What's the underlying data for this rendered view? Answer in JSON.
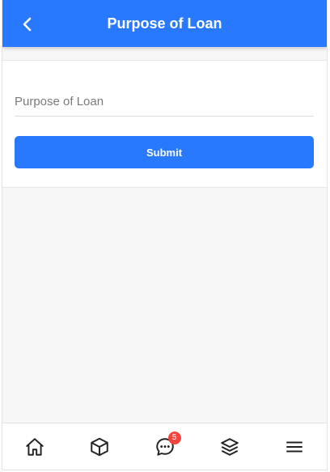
{
  "header": {
    "title": "Purpose of Loan",
    "back_icon": "chevron-left-icon",
    "background_color": "#2979ff"
  },
  "form": {
    "purpose_field": {
      "placeholder": "Purpose of Loan",
      "value": ""
    },
    "submit_label": "Submit",
    "submit_color": "#2979ff"
  },
  "tabbar": {
    "items": [
      {
        "icon": "home-icon"
      },
      {
        "icon": "cube-icon"
      },
      {
        "icon": "chat-icon",
        "badge": "5"
      },
      {
        "icon": "layers-icon"
      },
      {
        "icon": "menu-icon"
      }
    ],
    "badge_color": "#f2453d"
  }
}
